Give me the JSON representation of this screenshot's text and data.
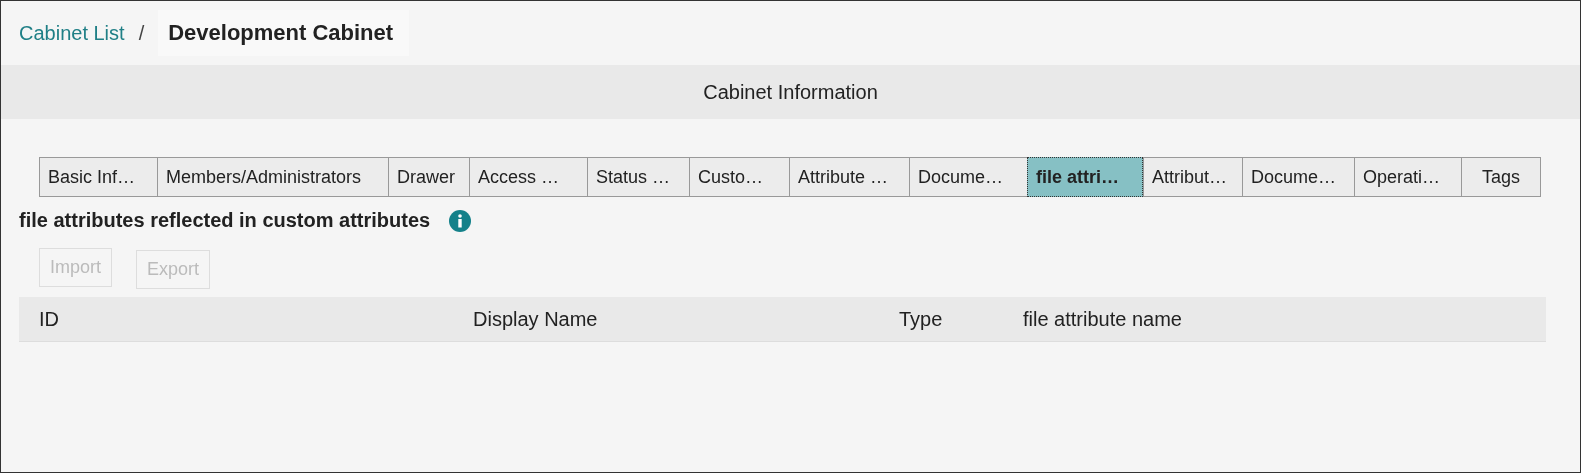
{
  "breadcrumb": {
    "parent": "Cabinet List",
    "separator": "/",
    "current": "Development Cabinet"
  },
  "section_title": "Cabinet Information",
  "tabs": [
    {
      "label": "Basic Inf…",
      "selected": false
    },
    {
      "label": "Members/Administrators",
      "selected": false
    },
    {
      "label": "Drawer",
      "selected": false
    },
    {
      "label": "Access …",
      "selected": false
    },
    {
      "label": "Status …",
      "selected": false
    },
    {
      "label": "Custo…",
      "selected": false
    },
    {
      "label": "Attribute …",
      "selected": false
    },
    {
      "label": "Docume…",
      "selected": false
    },
    {
      "label": "file attri…",
      "selected": true
    },
    {
      "label": "Attribut…",
      "selected": false
    },
    {
      "label": "Docume…",
      "selected": false
    },
    {
      "label": "Operati…",
      "selected": false
    },
    {
      "label": "Tags",
      "selected": false
    }
  ],
  "heading": "file attributes reflected in custom attributes",
  "buttons": [
    {
      "label": "Import",
      "disabled": true
    },
    {
      "label": "Export",
      "disabled": true
    }
  ],
  "table": {
    "columns": [
      "ID",
      "Display Name",
      "Type",
      "file attribute name"
    ]
  }
}
